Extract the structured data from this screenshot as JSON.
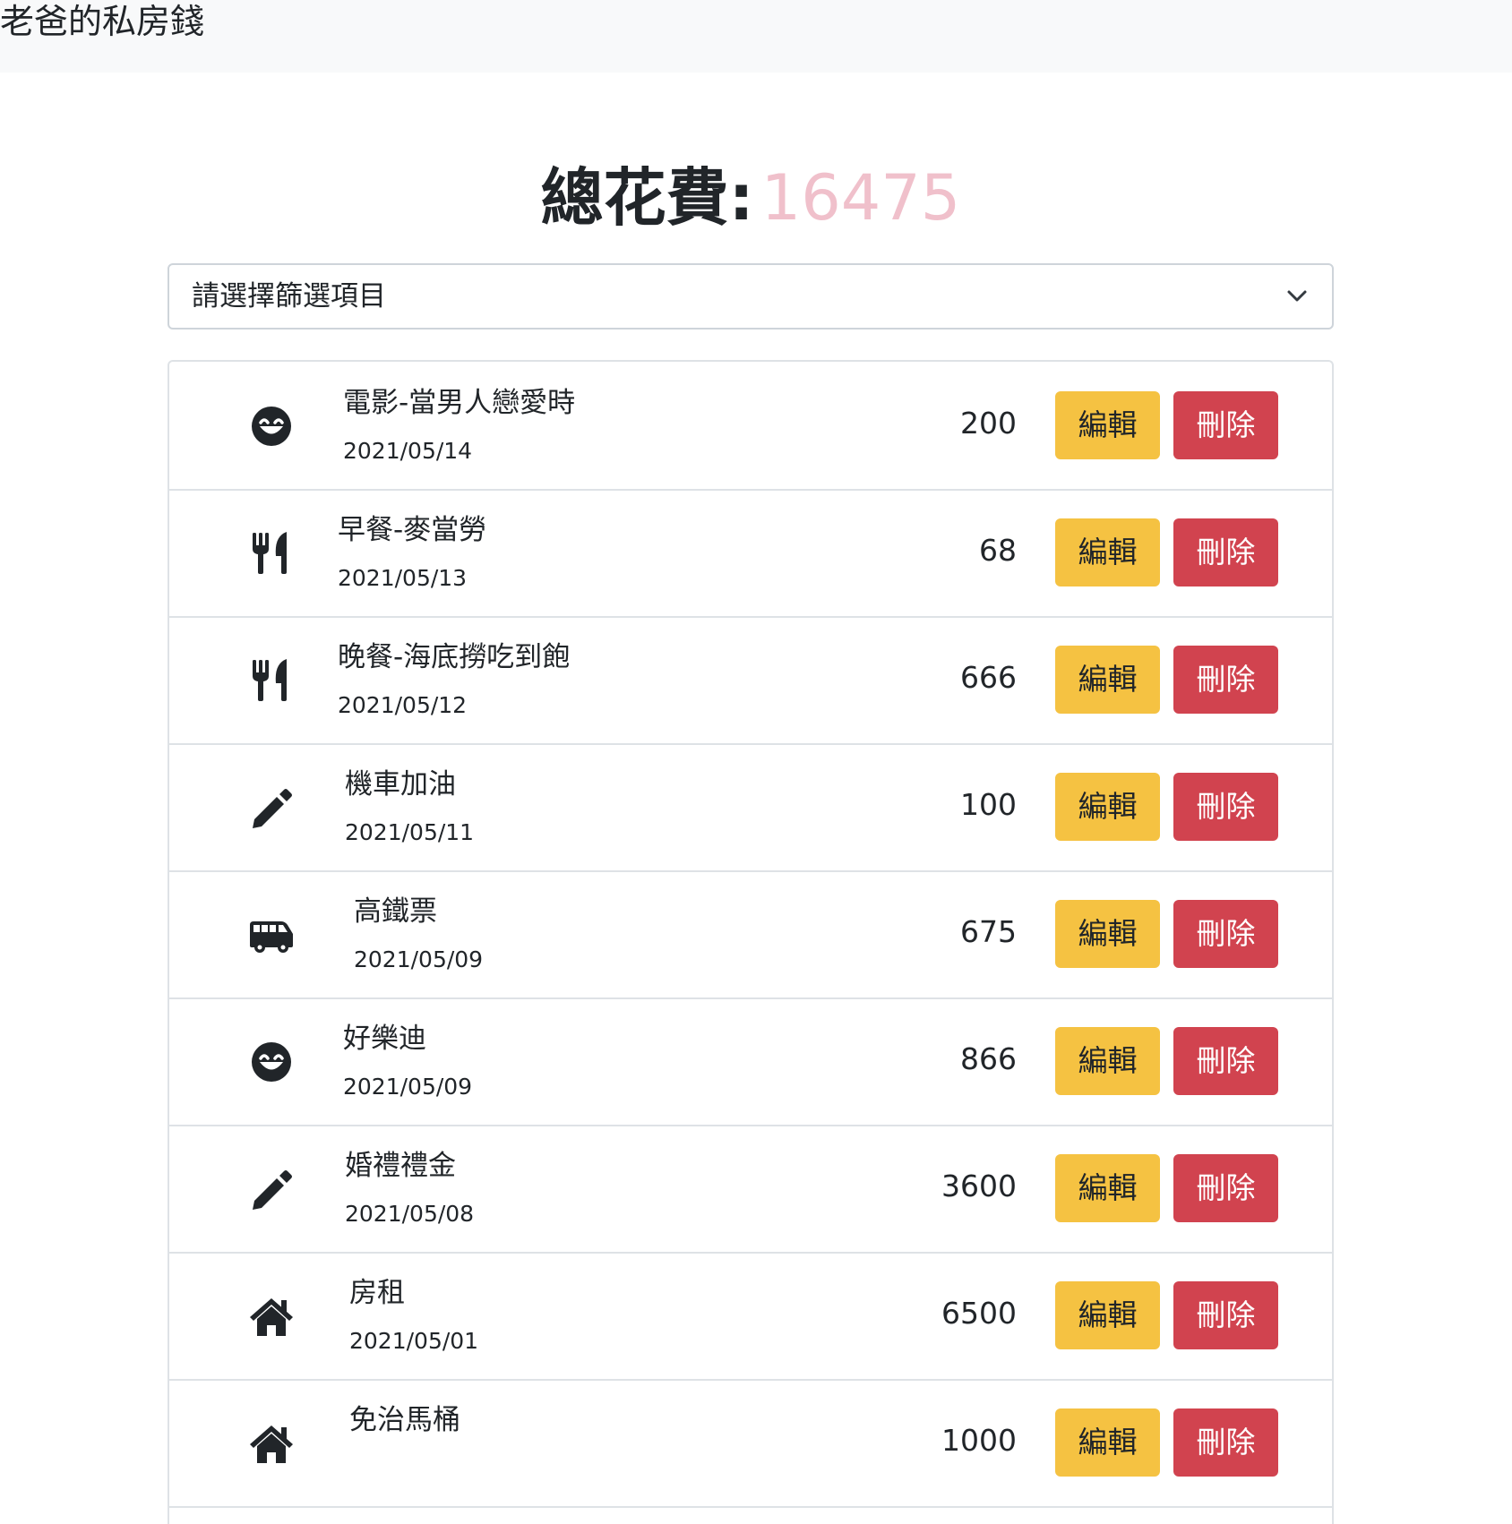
{
  "navbar": {
    "brand": "老爸的私房錢"
  },
  "summary": {
    "label": "總花費:",
    "value": "16475"
  },
  "filter": {
    "selected": "請選擇篩選項目"
  },
  "buttons": {
    "edit": "編輯",
    "delete": "刪除"
  },
  "records": [
    {
      "icon": "smile-icon",
      "title": "電影-當男人戀愛時",
      "date": "2021/05/14",
      "amount": "200"
    },
    {
      "icon": "utensils-icon",
      "title": "早餐-麥當勞",
      "date": "2021/05/13",
      "amount": "68"
    },
    {
      "icon": "utensils-icon",
      "title": "晚餐-海底撈吃到飽",
      "date": "2021/05/12",
      "amount": "666"
    },
    {
      "icon": "pencil-icon",
      "title": "機車加油",
      "date": "2021/05/11",
      "amount": "100"
    },
    {
      "icon": "shuttle-van-icon",
      "title": "高鐵票",
      "date": "2021/05/09",
      "amount": "675"
    },
    {
      "icon": "smile-icon",
      "title": "好樂迪",
      "date": "2021/05/09",
      "amount": "866"
    },
    {
      "icon": "pencil-icon",
      "title": "婚禮禮金",
      "date": "2021/05/08",
      "amount": "3600"
    },
    {
      "icon": "home-icon",
      "title": "房租",
      "date": "2021/05/01",
      "amount": "6500"
    },
    {
      "icon": "home-icon",
      "title": "免治馬桶",
      "date": "",
      "amount": "1000"
    }
  ]
}
